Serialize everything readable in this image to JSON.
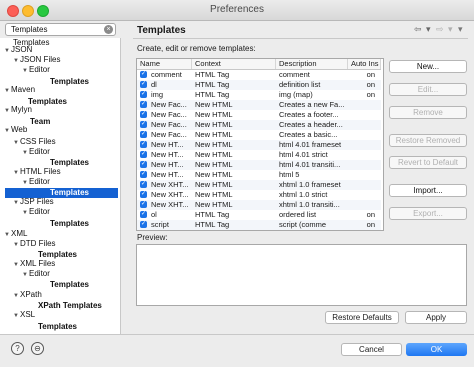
{
  "window": {
    "title": "Preferences"
  },
  "search": {
    "value": "Templates"
  },
  "tree": [
    {
      "label": "JSON",
      "expanded": true
    },
    {
      "label": "JSON Files",
      "expanded": true
    },
    {
      "label": "Editor",
      "expanded": true
    },
    {
      "label": "Templates"
    },
    {
      "label": "Maven",
      "expanded": true
    },
    {
      "label": "Templates"
    },
    {
      "label": "Mylyn",
      "expanded": true
    },
    {
      "label": "Team"
    },
    {
      "label": "Web",
      "expanded": true
    },
    {
      "label": "CSS Files",
      "expanded": true
    },
    {
      "label": "Editor",
      "expanded": true
    },
    {
      "label": "Templates"
    },
    {
      "label": "HTML Files",
      "expanded": true
    },
    {
      "label": "Editor",
      "expanded": true
    },
    {
      "label": "Templates",
      "selected": true
    },
    {
      "label": "JSP Files",
      "expanded": true
    },
    {
      "label": "Editor",
      "expanded": true
    },
    {
      "label": "Templates"
    },
    {
      "label": "XML",
      "expanded": true
    },
    {
      "label": "DTD Files",
      "expanded": true
    },
    {
      "label": "Templates"
    },
    {
      "label": "XML Files",
      "expanded": true
    },
    {
      "label": "Editor",
      "expanded": true
    },
    {
      "label": "Templates"
    },
    {
      "label": "XPath",
      "expanded": true
    },
    {
      "label": "XPath Templates"
    },
    {
      "label": "XSL",
      "expanded": true
    },
    {
      "label": "Templates"
    },
    {
      "label": "Templates"
    }
  ],
  "panel": {
    "title": "Templates",
    "description": "Create, edit or remove templates:",
    "preview_label": "Preview:"
  },
  "table": {
    "columns": [
      "Name",
      "Context",
      "Description",
      "Auto Ins"
    ],
    "rows": [
      {
        "name": "comment",
        "context": "HTML Tag",
        "description": "comment",
        "auto": "on"
      },
      {
        "name": "dl",
        "context": "HTML Tag",
        "description": "definition list",
        "auto": "on"
      },
      {
        "name": "img",
        "context": "HTML Tag",
        "description": "img     (map)",
        "auto": "on"
      },
      {
        "name": "New Fac...",
        "context": "New HTML",
        "description": "Creates a new Fa...",
        "auto": ""
      },
      {
        "name": "New Fac...",
        "context": "New HTML",
        "description": "Creates a footer...",
        "auto": ""
      },
      {
        "name": "New Fac...",
        "context": "New HTML",
        "description": "Creates a header...",
        "auto": ""
      },
      {
        "name": "New Fac...",
        "context": "New HTML",
        "description": "Creates a basic...",
        "auto": ""
      },
      {
        "name": "New HT...",
        "context": "New HTML",
        "description": "html 4.01 frameset",
        "auto": ""
      },
      {
        "name": "New HT...",
        "context": "New HTML",
        "description": "html 4.01 strict",
        "auto": ""
      },
      {
        "name": "New HT...",
        "context": "New HTML",
        "description": "html 4.01 transiti...",
        "auto": ""
      },
      {
        "name": "New HT...",
        "context": "New HTML",
        "description": "html 5",
        "auto": ""
      },
      {
        "name": "New XHT...",
        "context": "New HTML",
        "description": "xhtml 1.0 frameset",
        "auto": ""
      },
      {
        "name": "New XHT...",
        "context": "New HTML",
        "description": "xhtml 1.0 strict",
        "auto": ""
      },
      {
        "name": "New XHT...",
        "context": "New HTML",
        "description": "xhtml 1.0 transiti...",
        "auto": ""
      },
      {
        "name": "ol",
        "context": "HTML Tag",
        "description": "ordered list",
        "auto": "on"
      },
      {
        "name": "script",
        "context": "HTML Tag",
        "description": "script     (comme",
        "auto": "on"
      }
    ]
  },
  "buttons": {
    "new": "New...",
    "edit": "Edit...",
    "remove": "Remove",
    "restore_removed": "Restore Removed",
    "revert_default": "Revert to Default",
    "import": "Import...",
    "export": "Export...",
    "restore_defaults": "Restore Defaults",
    "apply": "Apply",
    "cancel": "Cancel",
    "ok": "OK"
  },
  "icons": {
    "clear": "×",
    "help": "?",
    "import_export": "⊖",
    "back": "⇦",
    "forward": "⇨",
    "dropdown": "▾",
    "check": "✓"
  },
  "colors": {
    "selection": "#1461d2",
    "accent": "#1f77f2"
  }
}
